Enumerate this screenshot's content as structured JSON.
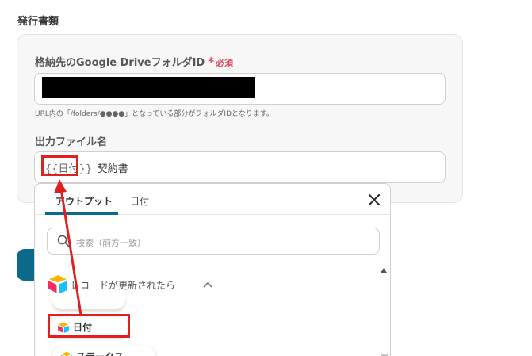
{
  "section_title": "発行書類",
  "folder_field": {
    "label": "格納先のGoogle DriveフォルダID",
    "required_mark": "*",
    "required_text": "必須",
    "help": "URL内の「/folders/●●●●」となっている部分がフォルダIDとなります。"
  },
  "filename_field": {
    "label": "出力ファイル名",
    "token": "{{日付}}",
    "suffix": "_契約書"
  },
  "dropdown": {
    "tabs": [
      "アウトプット",
      "日付"
    ],
    "search_placeholder": "検索（前方一致）",
    "group_label": "レコードが更新されたら",
    "items": [
      "日付",
      "ステータス"
    ]
  },
  "colors": {
    "accent": "#0b6a8a",
    "highlight": "#e02020",
    "required": "#e0445b"
  }
}
